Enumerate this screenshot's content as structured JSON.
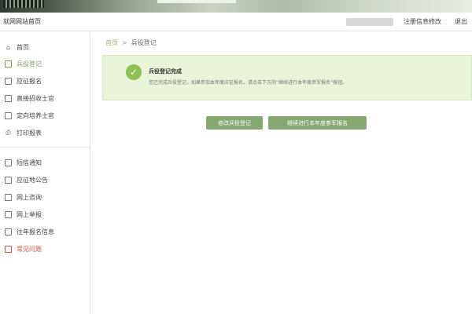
{
  "header": {
    "site_title": "就网网站首页",
    "links": [
      "注册信息修改",
      "退出"
    ]
  },
  "sidebar": {
    "items": [
      {
        "label": "首页",
        "icon": "home-icon"
      },
      {
        "label": "兵役登记",
        "icon": "document-icon",
        "active": true
      },
      {
        "label": "应征报名",
        "icon": "document-icon"
      },
      {
        "label": "直接招收士官",
        "icon": "document-icon"
      },
      {
        "label": "定向培养士官",
        "icon": "document-icon"
      },
      {
        "label": "打印报表",
        "icon": "printer-icon"
      },
      {
        "label": "短信通知",
        "icon": "document-icon"
      },
      {
        "label": "应征地公告",
        "icon": "document-icon"
      },
      {
        "label": "网上咨询",
        "icon": "document-icon"
      },
      {
        "label": "网上举报",
        "icon": "document-icon"
      },
      {
        "label": "往年报名信息",
        "icon": "document-icon"
      },
      {
        "label": "常见问题",
        "icon": "document-icon",
        "highlight": true
      }
    ]
  },
  "breadcrumb": {
    "home": "首页",
    "separator": ">",
    "current": "兵役登记"
  },
  "notice": {
    "title": "兵役登记完成",
    "text": "您已完成兵役登记，如果参加本年度应征报名，请点击下方的“继续进行本年度参军报名”按钮。"
  },
  "buttons": {
    "modify": "修改兵役登记",
    "continue": "继续进行本年度参军报名"
  },
  "colors": {
    "accent": "#86a771",
    "notice_bg": "#e9f4d9",
    "check": "#8dc155",
    "highlight": "#d0583a"
  }
}
